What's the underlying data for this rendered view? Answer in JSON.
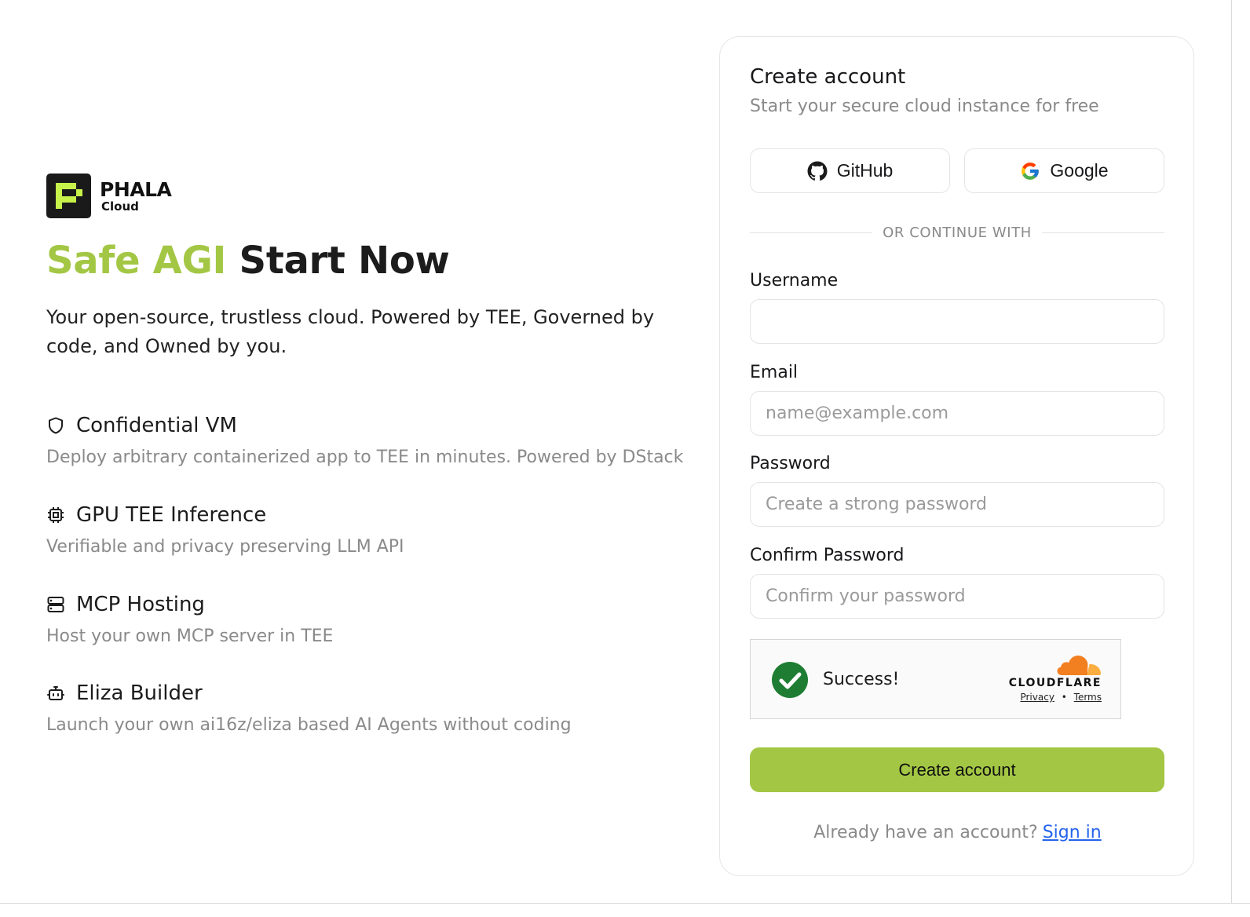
{
  "brand": {
    "name": "PHALA",
    "sub": "Cloud",
    "accent_color": "#a3c744",
    "logo_mark_color": "#c6f24a"
  },
  "hero": {
    "headline_accent": "Safe AGI",
    "headline_rest": "Start Now",
    "intro": "Your open-source, trustless cloud. Powered by TEE, Governed by code, and Owned by you."
  },
  "features": [
    {
      "icon": "shield-icon",
      "title": "Confidential VM",
      "desc": "Deploy arbitrary containerized app to TEE in minutes. Powered by DStack"
    },
    {
      "icon": "cpu-icon",
      "title": "GPU TEE Inference",
      "desc": "Verifiable and privacy preserving LLM API"
    },
    {
      "icon": "server-icon",
      "title": "MCP Hosting",
      "desc": "Host your own MCP server in TEE"
    },
    {
      "icon": "bot-icon",
      "title": "Eliza Builder",
      "desc": "Launch your own ai16z/eliza based AI Agents without coding"
    }
  ],
  "form": {
    "title": "Create account",
    "subtitle": "Start your secure cloud instance for free",
    "github_label": "GitHub",
    "google_label": "Google",
    "divider": "OR CONTINUE WITH",
    "username": {
      "label": "Username",
      "value": "",
      "placeholder": ""
    },
    "email": {
      "label": "Email",
      "value": "",
      "placeholder": "name@example.com"
    },
    "password": {
      "label": "Password",
      "value": "",
      "placeholder": "Create a strong password"
    },
    "confirm": {
      "label": "Confirm Password",
      "value": "",
      "placeholder": "Confirm your password"
    },
    "captcha": {
      "status": "Success!",
      "provider": "CLOUDFLARE",
      "privacy": "Privacy",
      "separator": "•",
      "terms": "Terms",
      "success_color": "#1e7d32"
    },
    "submit_label": "Create account",
    "signin_prompt": "Already have an account?",
    "signin_link": "Sign in",
    "link_color": "#2563eb"
  }
}
